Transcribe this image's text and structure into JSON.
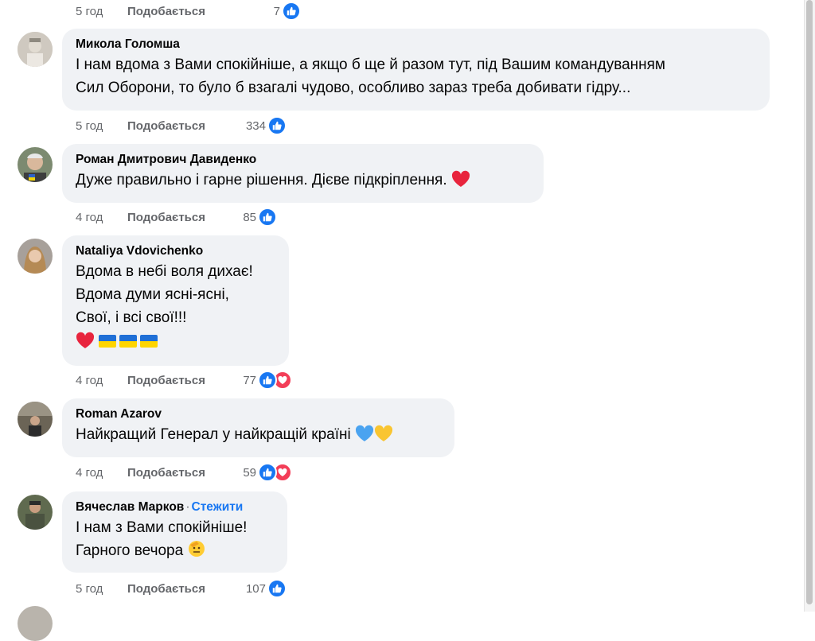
{
  "top_meta": {
    "time": "5 год",
    "like": "Подобається",
    "count": "7"
  },
  "comments": [
    {
      "author": "Микола Голомша",
      "lines": [
        "І нам вдома з Вами спокійніше, а якщо б ще й разом тут, під Вашим командуванням",
        "Сил Оборони, то було б взагалі чудово, особливо зараз треба добивати гідру..."
      ],
      "time": "5 год",
      "like": "Подобається",
      "count": "334"
    },
    {
      "author": "Роман Дмитрович Давиденко",
      "lines": [
        "Дуже правильно і гарне рішення. Дієве підкріплення."
      ],
      "time": "4 год",
      "like": "Подобається",
      "count": "85"
    },
    {
      "author": "Nataliya Vdovichenko",
      "lines": [
        "Вдома в небі воля дихає!",
        "Вдома думи ясні-ясні,",
        "Свої, і всі свої!!!"
      ],
      "time": "4 год",
      "like": "Подобається",
      "count": "77"
    },
    {
      "author": "Roman Azarov",
      "lines": [
        "Найкращий Генерал у найкращій країні"
      ],
      "time": "4 год",
      "like": "Подобається",
      "count": "59"
    },
    {
      "author": "Вячеслав Марков",
      "follow": "Стежити",
      "lines": [
        "І нам з Вами спокійніше!",
        "Гарного вечора"
      ],
      "time": "5 год",
      "like": "Подобається",
      "count": "107"
    }
  ],
  "colors": {
    "bubble": "#f0f2f5",
    "meta_text": "#65676b",
    "link_blue": "#1877f2",
    "like_reaction": "#1877f2",
    "love_reaction": "#f33e58"
  },
  "icons": [
    "like-reaction-icon",
    "love-reaction-icon",
    "heart-emoji",
    "ukraine-flag-emoji",
    "blue-heart-emoji",
    "yellow-heart-emoji",
    "saluting-face-emoji"
  ]
}
